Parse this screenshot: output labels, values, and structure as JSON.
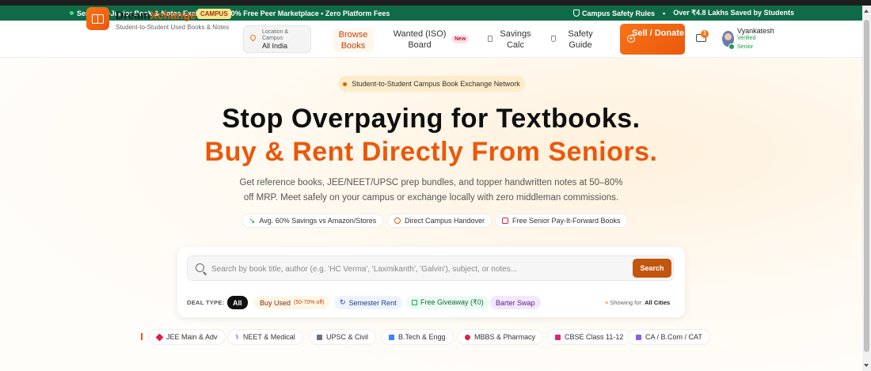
{
  "promo": {
    "text": "Senior-to-Junior Book & Notes Exchange • 100% Free Peer Marketplace • Zero Platform Fees",
    "safety": "Campus Safety Rules",
    "saved": "Over ₹4.8 Lakhs Saved by Students"
  },
  "brand": {
    "name_a": "Dream",
    "name_b": "Xchange",
    "badge": "CAMPUS",
    "tagline": "Student-to-Student Used Books & Notes"
  },
  "location": {
    "label": "Location & Campus",
    "value": "All India"
  },
  "nav": {
    "browse": "Browse Books",
    "wanted": "Wanted (ISO) Board",
    "new_badge": "New",
    "savings": "Savings Calc",
    "safety": "Safety Guide",
    "sell": "Sell / Donate"
  },
  "notifications": {
    "count": "1"
  },
  "user": {
    "name": "Vyankatesh",
    "verified": "Verified",
    "role": "Senior"
  },
  "hero": {
    "pill": "Student-to-Student Campus Book Exchange Network",
    "title1": "Stop Overpaying for Textbooks.",
    "title2": "Buy & Rent Directly From Seniors.",
    "subtitle": "Get reference books, JEE/NEET/UPSC prep bundles, and topper handwritten notes at 50–80% off MRP. Meet safely on your campus or exchange locally with zero middleman commissions.",
    "chips": [
      "Avg. 60% Savings vs Amazon/Stores",
      "Direct Campus Handover",
      "Free Senior Pay-It-Forward Books"
    ]
  },
  "search": {
    "placeholder": "Search by book title, author (e.g. 'HC Verma', 'Laxmikanth', 'Galvin'), subject, or notes...",
    "button": "Search",
    "deal_label": "DEAL TYPE:",
    "deals": [
      "All",
      "Buy Used",
      "Semester Rent",
      "Free Giveaway (₹0)",
      "Barter Swap"
    ],
    "buy_note": "(50-70% off)",
    "showing_prefix": "Showing for:",
    "showing_value": "All Cities"
  },
  "categories": [
    "JEE Main & Adv",
    "NEET & Medical",
    "UPSC & Civil",
    "B.Tech & Engg",
    "MBBS & Pharmacy",
    "CBSE Class 11-12",
    "CA / B.Com / CAT"
  ],
  "colors": {
    "accent": "#ea580c",
    "promo_bg": "#0f6b47",
    "search_btn": "#c2560f"
  }
}
